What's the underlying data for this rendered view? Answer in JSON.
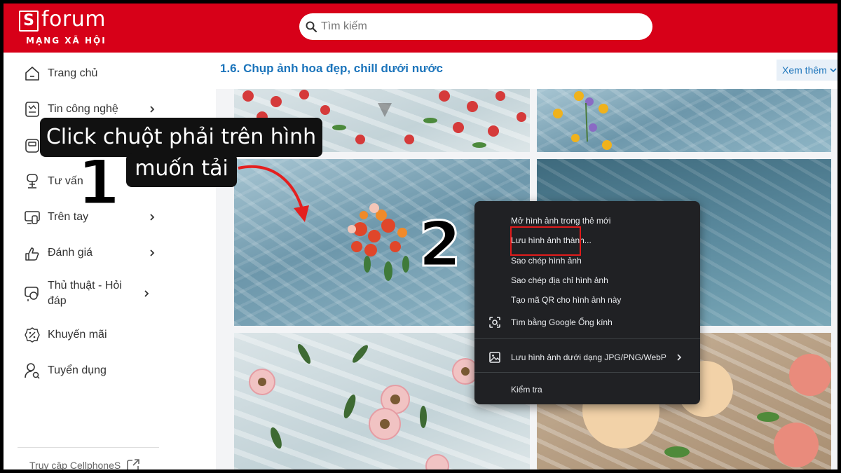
{
  "header": {
    "logo_letter": "S",
    "logo_word": "forum",
    "logo_sub": "MẠNG XÃ HỘI",
    "search_placeholder": "Tìm kiếm"
  },
  "sidebar": {
    "items": [
      {
        "label": "Trang chủ",
        "icon": "home-icon",
        "has_chevron": false
      },
      {
        "label": "Tin công nghệ",
        "icon": "news-icon",
        "has_chevron": true
      },
      {
        "label": "",
        "icon": "device-icon",
        "has_chevron": false
      },
      {
        "label": "Tư vấn",
        "icon": "advice-icon",
        "has_chevron": false
      },
      {
        "label": "Trên tay",
        "icon": "hands-on-icon",
        "has_chevron": true
      },
      {
        "label": "Đánh giá",
        "icon": "thumbs-icon",
        "has_chevron": true
      },
      {
        "label": "Thủ thuật - Hỏi đáp",
        "icon": "tips-icon",
        "has_chevron": true
      },
      {
        "label": "Khuyến mãi",
        "icon": "promo-badge-icon",
        "has_chevron": false
      },
      {
        "label": "Tuyển dụng",
        "icon": "recruit-icon",
        "has_chevron": false
      }
    ],
    "footer_label": "Truy cập CellphoneS"
  },
  "content": {
    "section_title": "1.6. Chụp ảnh hoa đẹp, chill dưới nước",
    "more_label": "Xem thêm"
  },
  "context_menu": {
    "items": [
      {
        "label": "Mở hình ảnh trong thẻ mới"
      },
      {
        "label": "Lưu hình ảnh thành..."
      },
      {
        "label": "Sao chép hình ảnh"
      },
      {
        "label": "Sao chép địa chỉ hình ảnh"
      },
      {
        "label": "Tạo mã QR cho hình ảnh này"
      },
      {
        "label": "Tìm bằng Google Ống kính",
        "icon": "google-lens-icon"
      },
      {
        "label": "Lưu hình ảnh dưới dạng JPG/PNG/WebP",
        "icon": "image-save-icon",
        "submenu": true
      },
      {
        "label": "Kiểm tra"
      }
    ]
  },
  "annotations": {
    "step1_line1": "Click chuột phải trên hình",
    "step1_line2": "muốn tải",
    "step1_number": "1",
    "step2_number": "2"
  },
  "colors": {
    "brand_red": "#d70018",
    "link_blue": "#1b74bb",
    "menu_bg": "#202124",
    "highlight_red": "#e01b1b"
  }
}
